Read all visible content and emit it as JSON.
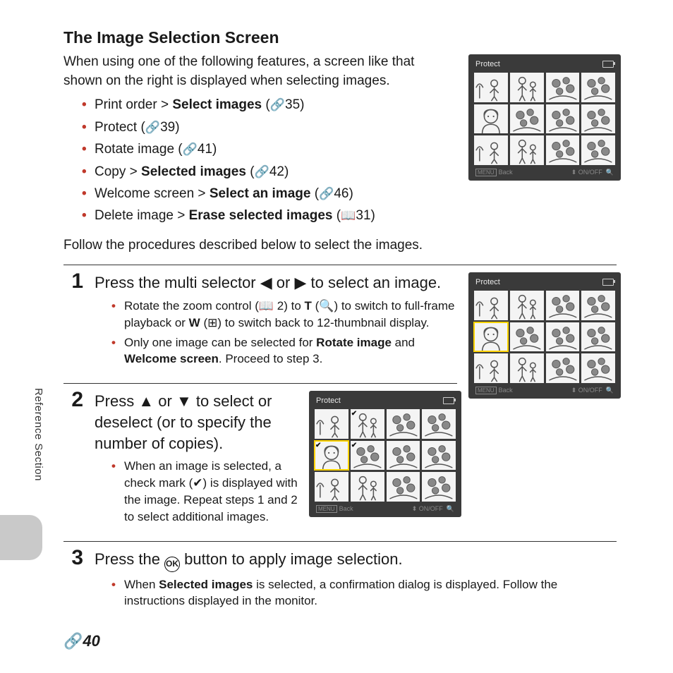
{
  "title": "The Image Selection Screen",
  "intro": "When using one of the following features, a screen like that shown on the right is displayed when selecting images.",
  "features": [
    {
      "pre": "Print order > ",
      "bold": "Select images",
      "icon": "ref",
      "page": "35"
    },
    {
      "pre": "Protect (",
      "bold": "",
      "icon": "ref",
      "page": "39",
      "post": ")"
    },
    {
      "pre": "Rotate image (",
      "bold": "",
      "icon": "ref",
      "page": "41",
      "post": ")"
    },
    {
      "pre": "Copy > ",
      "bold": "Selected images",
      "icon": "ref",
      "page": "42"
    },
    {
      "pre": "Welcome screen > ",
      "bold": "Select an image",
      "icon": "ref",
      "page": "46"
    },
    {
      "pre": "Delete image > ",
      "bold": "Erase selected images",
      "icon": "book",
      "page": "31"
    }
  ],
  "follow": "Follow the procedures described below to select the images.",
  "steps": [
    {
      "num": "1",
      "lead_parts": [
        "Press the multi selector ",
        " or ",
        " to select an image."
      ],
      "notes": [
        {
          "html": "Rotate the zoom control (📖 2) to <b>T</b> (🔍) to switch to full-frame playback or <b>W</b> (⊞) to switch back to 12-thumbnail display."
        },
        {
          "html": "Only one image can be selected for <b>Rotate image</b> and <b>Welcome screen</b>. Proceed to step 3."
        }
      ]
    },
    {
      "num": "2",
      "lead_parts": [
        "Press ",
        " or ",
        " to select or deselect (or to specify the number of copies)."
      ],
      "notes": [
        {
          "html": "When an image is selected, a check mark (✔) is displayed with the image. Repeat steps 1 and 2 to select additional images."
        }
      ]
    },
    {
      "num": "3",
      "lead_parts": [
        "Press the ",
        " button to apply image selection."
      ],
      "notes": [
        {
          "html": "When <b>Selected images</b> is selected, a confirmation dialog is displayed. Follow the instructions displayed in the monitor."
        }
      ]
    }
  ],
  "lcd": {
    "title": "Protect",
    "foot_back": "Back",
    "foot_onoff": "ON/OFF"
  },
  "side_label": "Reference Section",
  "page_number": "40",
  "icons": {
    "ref": "🔗",
    "book": "📖",
    "left": "◀",
    "right": "▶",
    "up": "▲",
    "down": "▼",
    "ok": "Ⓚ",
    "check": "✔",
    "mag": "🔍"
  }
}
